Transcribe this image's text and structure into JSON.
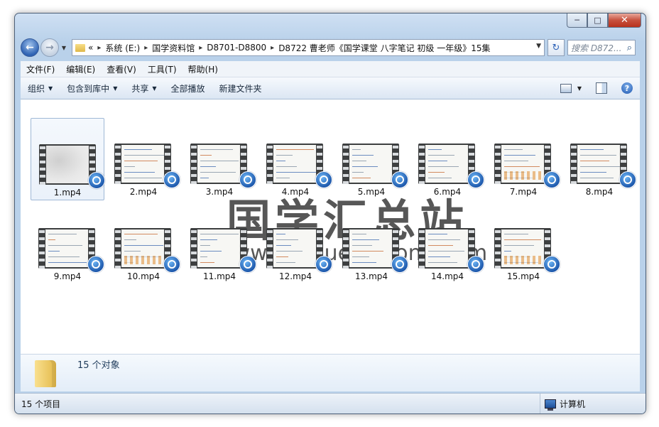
{
  "window": {
    "caption_buttons": {
      "minimize": "─",
      "maximize": "□",
      "close": "✕"
    }
  },
  "nav": {
    "back_icon": "back-arrow-icon",
    "forward_icon": "forward-arrow-icon"
  },
  "address": {
    "overflow": "«",
    "breadcrumbs": [
      "系统 (E:)",
      "国学资料馆",
      "D8701-D8800",
      "D8722 曹老师《国学课堂 八字笔记 初级 一年级》15集"
    ],
    "separator": "▸"
  },
  "search": {
    "placeholder": "搜索 D872..."
  },
  "menu": [
    "文件(F)",
    "编辑(E)",
    "查看(V)",
    "工具(T)",
    "帮助(H)"
  ],
  "commands": {
    "organize": "组织",
    "include_in_library": "包含到库中",
    "share": "共享",
    "play_all": "全部播放",
    "new_folder": "新建文件夹"
  },
  "files": [
    {
      "name": "1.mp4",
      "style": "blur",
      "selected": true
    },
    {
      "name": "2.mp4",
      "style": "lines"
    },
    {
      "name": "3.mp4",
      "style": "lines"
    },
    {
      "name": "4.mp4",
      "style": "lines"
    },
    {
      "name": "5.mp4",
      "style": "lines"
    },
    {
      "name": "6.mp4",
      "style": "lines"
    },
    {
      "name": "7.mp4",
      "style": "grid"
    },
    {
      "name": "8.mp4",
      "style": "lines"
    },
    {
      "name": "9.mp4",
      "style": "lines"
    },
    {
      "name": "10.mp4",
      "style": "grid"
    },
    {
      "name": "11.mp4",
      "style": "lines"
    },
    {
      "name": "12.mp4",
      "style": "lines"
    },
    {
      "name": "13.mp4",
      "style": "lines"
    },
    {
      "name": "14.mp4",
      "style": "lines"
    },
    {
      "name": "15.mp4",
      "style": "grid"
    }
  ],
  "watermark": {
    "text": "国学汇总站",
    "url": "www.guoxuehuizong.com"
  },
  "details": {
    "summary": "15 个对象"
  },
  "status": {
    "count": "15 个项目",
    "location": "计算机"
  }
}
